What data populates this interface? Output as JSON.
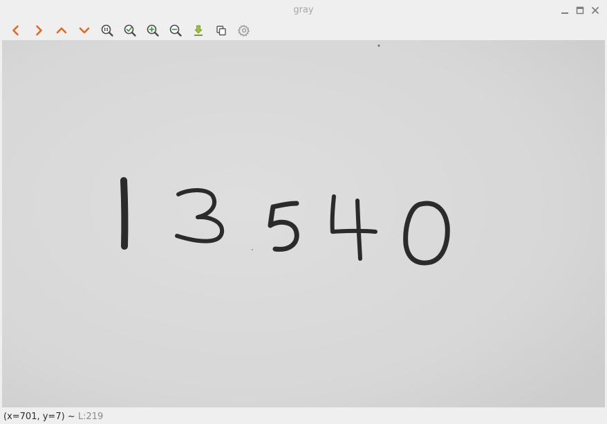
{
  "window": {
    "title": "gray",
    "controls": [
      "minimize-icon",
      "maximize-icon",
      "close-icon"
    ]
  },
  "toolbar": {
    "buttons": [
      {
        "name": "back-button",
        "icon": "chevron-left-icon",
        "color": "#e8661c"
      },
      {
        "name": "forward-button",
        "icon": "chevron-right-icon",
        "color": "#e8661c"
      },
      {
        "name": "up-button",
        "icon": "chevron-up-icon",
        "color": "#e8661c"
      },
      {
        "name": "down-button",
        "icon": "chevron-down-icon",
        "color": "#e8661c"
      },
      {
        "name": "zoom-original-button",
        "icon": "zoom-original-icon",
        "color": "#555555"
      },
      {
        "name": "zoom-fit-button",
        "icon": "zoom-fit-icon",
        "color": "#3a9a3a"
      },
      {
        "name": "zoom-in-button",
        "icon": "zoom-in-icon",
        "color": "#3a9a3a"
      },
      {
        "name": "zoom-out-button",
        "icon": "zoom-out-icon",
        "color": "#3a9a3a"
      },
      {
        "name": "save-button",
        "icon": "download-icon",
        "color": "#8ab22a"
      },
      {
        "name": "copy-button",
        "icon": "copy-icon",
        "color": "#555555"
      },
      {
        "name": "properties-button",
        "icon": "gear-icon",
        "color": "#9a9a9a"
      }
    ]
  },
  "image": {
    "handwritten_text": "13540"
  },
  "status": {
    "coords": "(x=701, y=7)",
    "separator": " ~ ",
    "level": "L:219"
  },
  "colors": {
    "window_bg": "#efefef",
    "paper": "#d9d9d9",
    "ink": "#2b2b2b",
    "accent_orange": "#e8661c"
  }
}
